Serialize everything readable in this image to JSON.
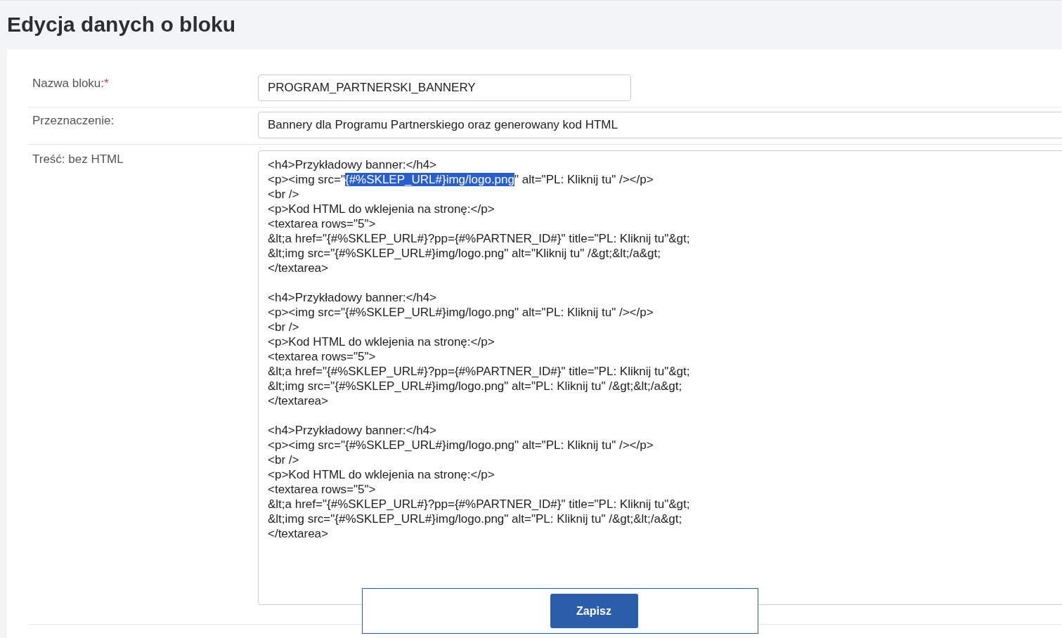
{
  "page_title": "Edycja danych o bloku",
  "fields": [
    {
      "label": "Nazwa bloku:",
      "required_mark": "*",
      "value": "PROGRAM_PARTNERSKI_BANNERY",
      "kind": "short"
    },
    {
      "label": "Przeznaczenie:",
      "value": "Bannery dla Programu Partnerskiego oraz generowany kod HTML",
      "kind": "wide"
    }
  ],
  "content": {
    "label": "Treść: bez HTML",
    "blocks": [
      {
        "lines": [
          {
            "segments": [
              {
                "text": "<h4>Przykładowy banner:</h4>",
                "selected": false
              }
            ]
          },
          {
            "segments": [
              {
                "text": "<p><img src=\"",
                "selected": false
              },
              {
                "text": "{#%SKLEP_URL#}img/logo.png",
                "selected": true
              },
              {
                "text": "\" alt=\"PL: Kliknij tu\" /></p>",
                "selected": false
              }
            ]
          },
          {
            "segments": [
              {
                "text": "<br />",
                "selected": false
              }
            ]
          },
          {
            "segments": [
              {
                "text": "<p>Kod HTML do wklejenia na stronę:</p>",
                "selected": false
              }
            ]
          },
          {
            "segments": [
              {
                "text": "<textarea rows=\"5\">",
                "selected": false
              }
            ]
          },
          {
            "segments": [
              {
                "text": "&lt;a href=\"{#%SKLEP_URL#}?pp={#%PARTNER_ID#}\" title=\"PL: Kliknij tu\"&gt;",
                "selected": false
              }
            ]
          },
          {
            "segments": [
              {
                "text": "&lt;img src=\"{#%SKLEP_URL#}img/logo.png\" alt=\"Kliknij tu\" /&gt;&lt;/a&gt;",
                "selected": false
              }
            ]
          },
          {
            "segments": [
              {
                "text": "</textarea>",
                "selected": false
              }
            ]
          }
        ]
      },
      {
        "lines": [
          {
            "segments": [
              {
                "text": "<h4>Przykładowy banner:</h4>",
                "selected": false
              }
            ]
          },
          {
            "segments": [
              {
                "text": "<p><img src=\"{#%SKLEP_URL#}img/logo.png\" alt=\"PL: Kliknij tu\" /></p>",
                "selected": false
              }
            ]
          },
          {
            "segments": [
              {
                "text": "<br />",
                "selected": false
              }
            ]
          },
          {
            "segments": [
              {
                "text": "<p>Kod HTML do wklejenia na stronę:</p>",
                "selected": false
              }
            ]
          },
          {
            "segments": [
              {
                "text": "<textarea rows=\"5\">",
                "selected": false
              }
            ]
          },
          {
            "segments": [
              {
                "text": "&lt;a href=\"{#%SKLEP_URL#}?pp={#%PARTNER_ID#}\" title=\"PL: Kliknij tu\"&gt;",
                "selected": false
              }
            ]
          },
          {
            "segments": [
              {
                "text": "&lt;img src=\"{#%SKLEP_URL#}img/logo.png\" alt=\"PL: Kliknij tu\" /&gt;&lt;/a&gt;",
                "selected": false
              }
            ]
          },
          {
            "segments": [
              {
                "text": "</textarea>",
                "selected": false
              }
            ]
          }
        ]
      },
      {
        "lines": [
          {
            "segments": [
              {
                "text": "<h4>Przykładowy banner:</h4>",
                "selected": false
              }
            ]
          },
          {
            "segments": [
              {
                "text": "<p><img src=\"{#%SKLEP_URL#}img/logo.png\" alt=\"PL: Kliknij tu\" /></p>",
                "selected": false
              }
            ]
          },
          {
            "segments": [
              {
                "text": "<br />",
                "selected": false
              }
            ]
          },
          {
            "segments": [
              {
                "text": "<p>Kod HTML do wklejenia na stronę:</p>",
                "selected": false
              }
            ]
          },
          {
            "segments": [
              {
                "text": "<textarea rows=\"5\">",
                "selected": false
              }
            ]
          },
          {
            "segments": [
              {
                "text": "&lt;a href=\"{#%SKLEP_URL#}?pp={#%PARTNER_ID#}\" title=\"PL: Kliknij tu\"&gt;",
                "selected": false
              }
            ]
          },
          {
            "segments": [
              {
                "text": "&lt;img src=\"{#%SKLEP_URL#}img/logo.png\" alt=\"PL: Kliknij tu\" /&gt;&lt;/a&gt;",
                "selected": false
              }
            ]
          },
          {
            "segments": [
              {
                "text": "</textarea>",
                "selected": false
              }
            ]
          }
        ]
      }
    ]
  },
  "save_button": "Zapisz"
}
